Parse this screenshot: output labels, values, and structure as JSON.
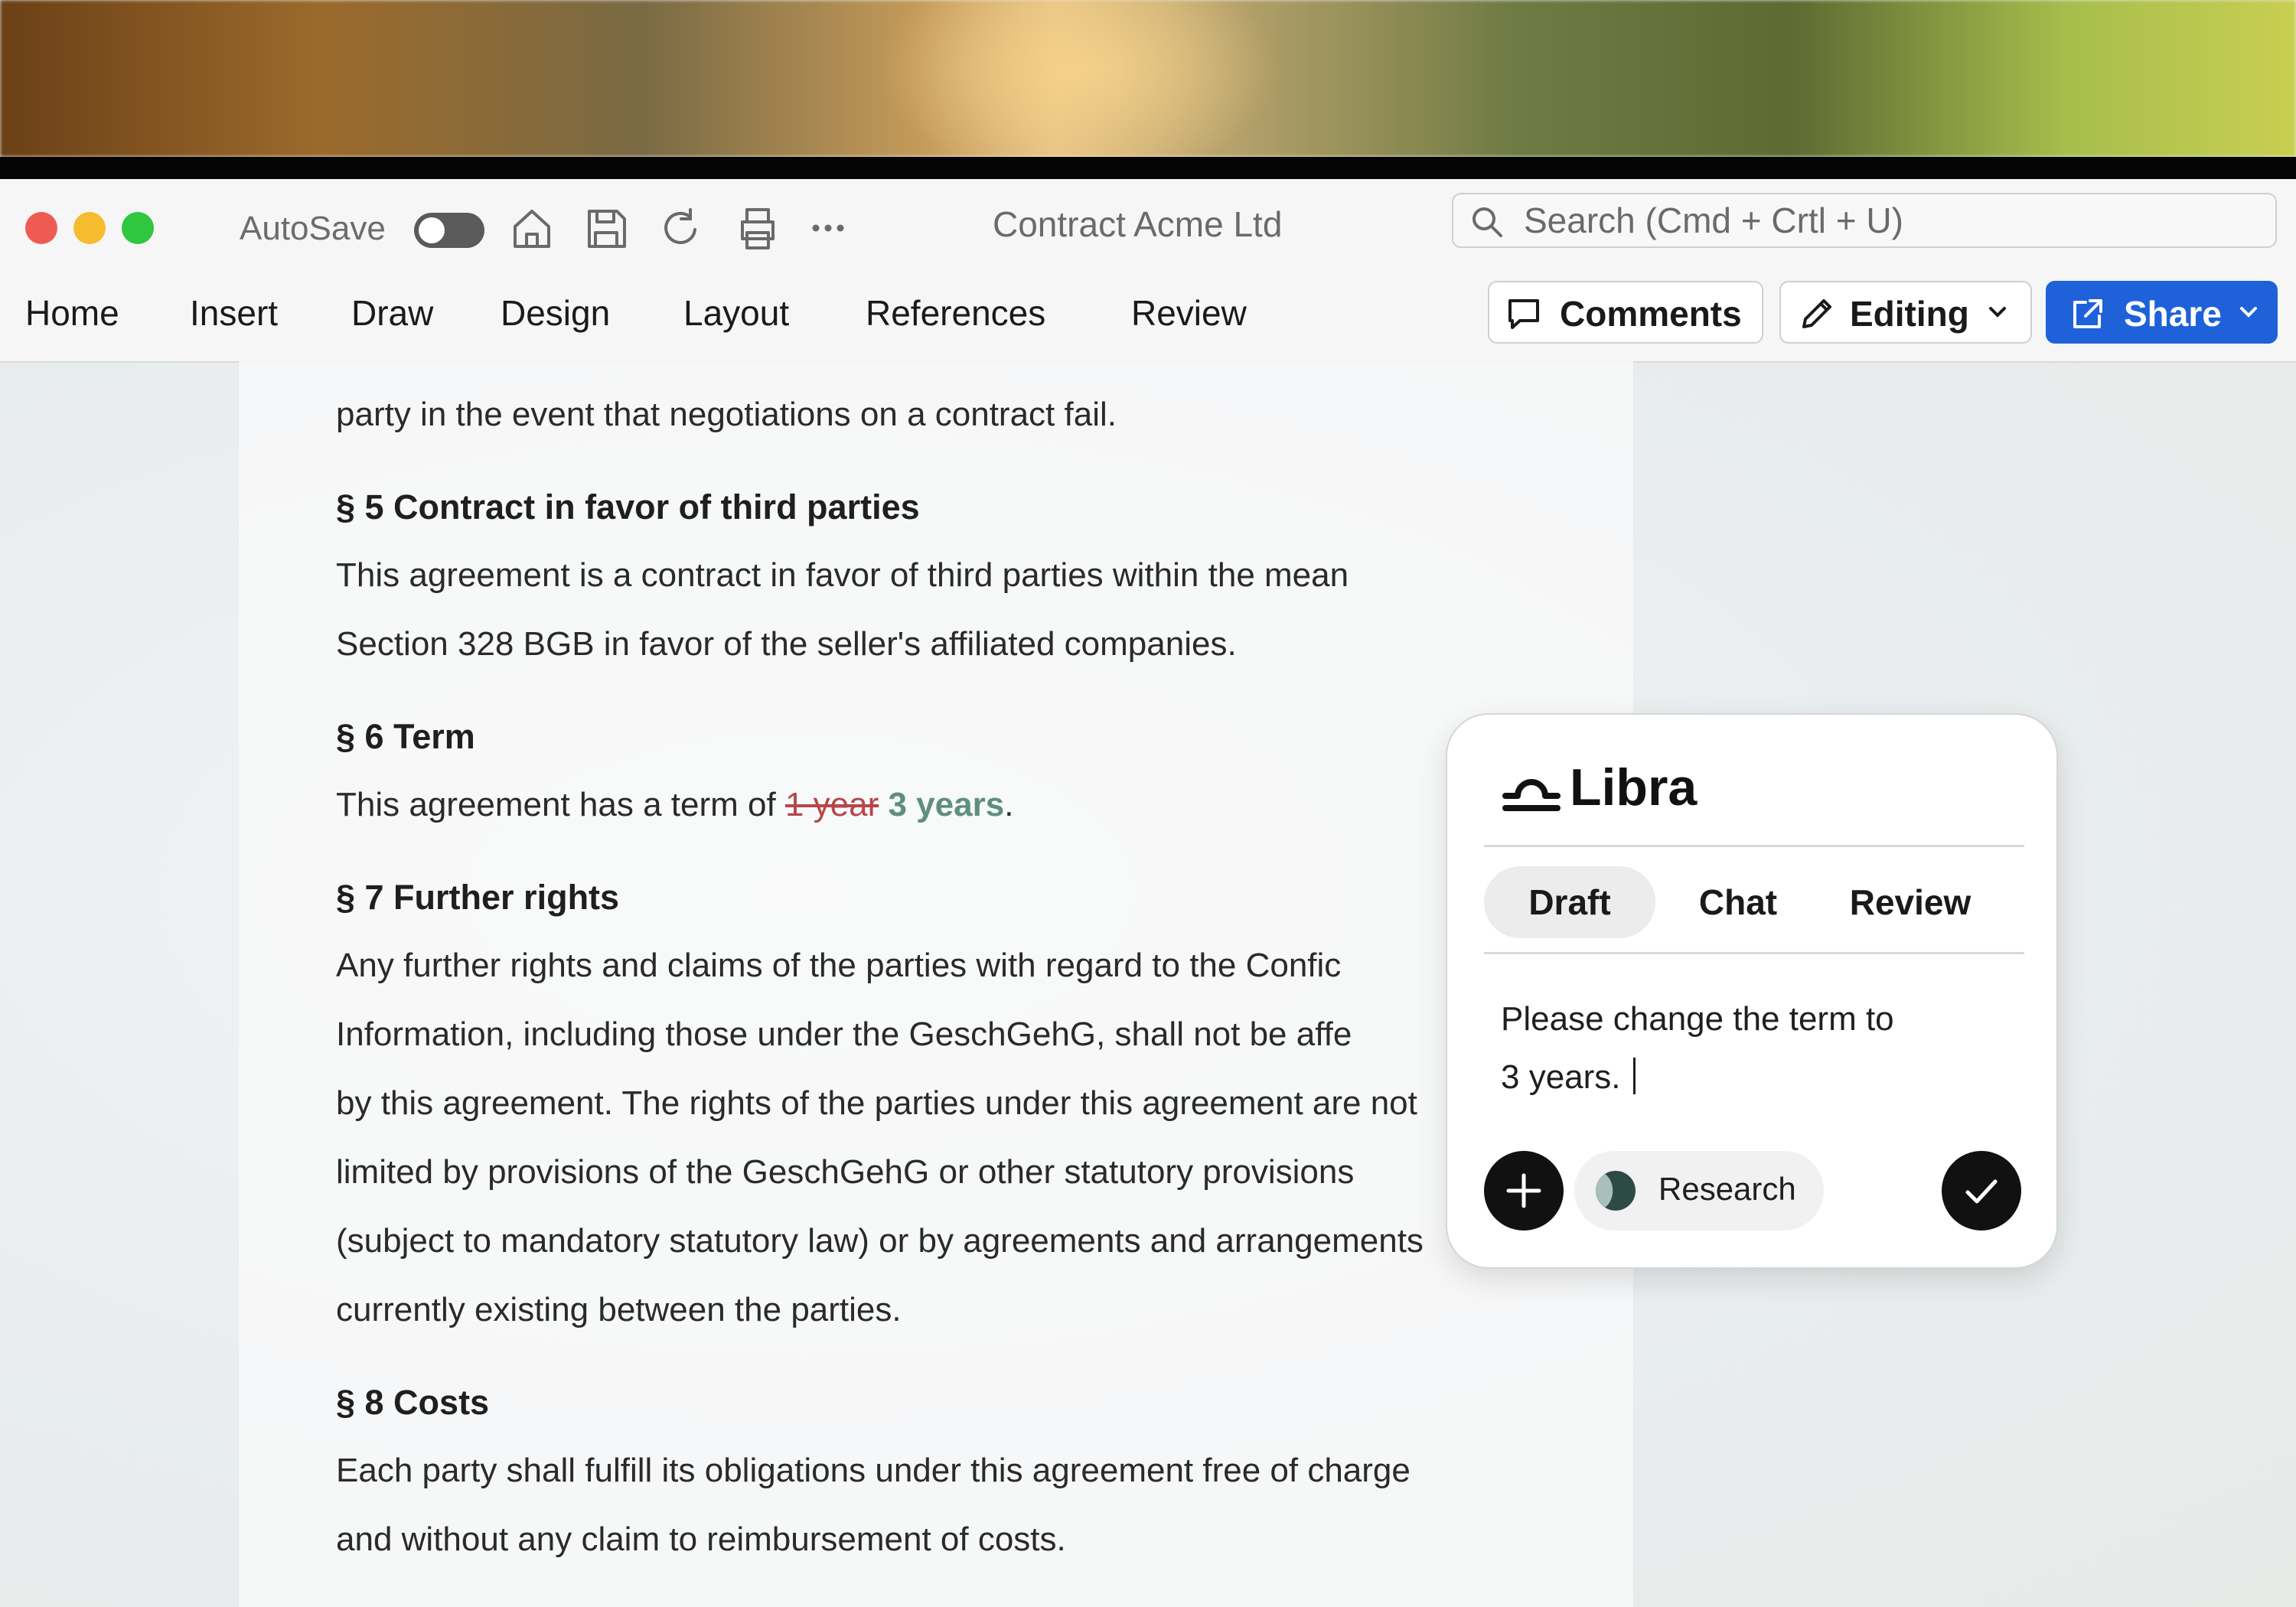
{
  "window": {
    "title": "Contract Acme Ltd",
    "autosave_label": "AutoSave",
    "autosave_on": false,
    "search_placeholder": "Search (Cmd + Crtl + U)"
  },
  "menu": [
    "Home",
    "Insert",
    "Draw",
    "Design",
    "Layout",
    "References",
    "Review"
  ],
  "actions": {
    "comments": "Comments",
    "editing": "Editing",
    "share": "Share",
    "share_color": "#1f61d9"
  },
  "document": {
    "partial_line": "party in the event that negotiations on a contract fail.",
    "s5_heading": "§ 5 Contract in favor of third parties",
    "s5_line1": "This agreement is a contract in favor of third parties within the mean",
    "s5_line2": "Section 328 BGB in favor of the seller's affiliated companies.",
    "s6_heading": "§ 6 Term",
    "s6_prefix": "This agreement has a term of",
    "s6_deleted": "1 year",
    "s6_inserted": "3 years",
    "s6_suffix": ".",
    "s7_heading": "§ 7 Further rights",
    "s7_line1": "Any further rights and claims of the parties with regard to the Confic",
    "s7_line2": "Information, including those under the GeschGehG, shall not be affe",
    "s7_line3": "by this agreement. The rights of the parties under this agreement are not",
    "s7_line4": "limited by provisions of the GeschGehG or other statutory provisions",
    "s7_line5": "(subject to mandatory statutory law) or by agreements and arrangements",
    "s7_line6": "currently existing between the parties.",
    "s8_heading": "§ 8 Costs",
    "s8_line1": "Each party shall fulfill its obligations under this agreement free of charge",
    "s8_line2": "and without any claim to reimbursement of costs.",
    "deleted_color": "#b5474b",
    "inserted_color": "#5e8f7d"
  },
  "assistant": {
    "name": "Libra",
    "tabs": [
      "Draft",
      "Chat",
      "Review"
    ],
    "active_tab": "Draft",
    "prompt_line1": "Please change the term to",
    "prompt_line2": "3 years.",
    "research_label": "Research"
  }
}
